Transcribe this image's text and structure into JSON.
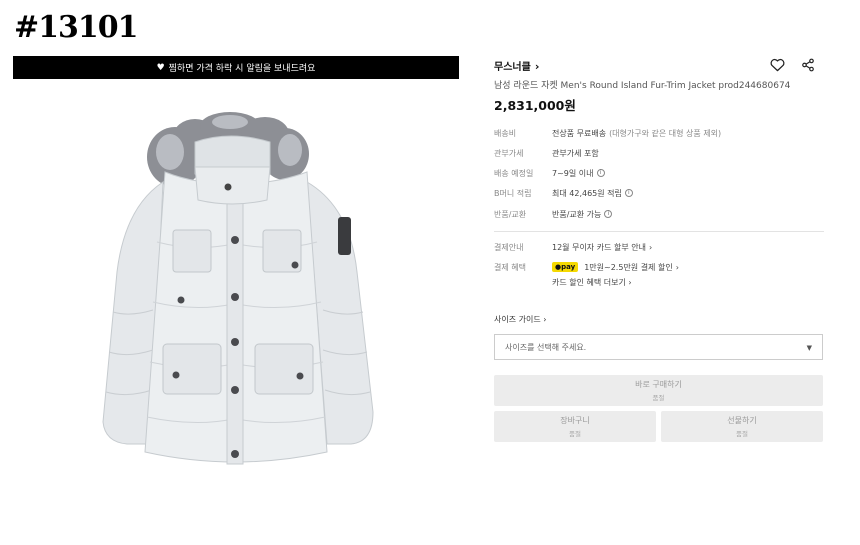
{
  "page_id": "#13101",
  "banner": {
    "text": "찜하면 가격 하락 시 알림을 보내드려요"
  },
  "product": {
    "brand": "무스너클",
    "name": "남성 라운드 자켓 Men's Round Island Fur-Trim Jacket prod244680674",
    "price": "2,831,000원"
  },
  "info": [
    {
      "label": "배송비",
      "value": "전상품 무료배송",
      "note": "(대형가구와 같은 대형 상품 제외)",
      "icon": ""
    },
    {
      "label": "관부가세",
      "value": "관부가세 포함",
      "note": "",
      "icon": ""
    },
    {
      "label": "배송 예정일",
      "value": "7~9일 이내",
      "note": "",
      "icon": "info-icon"
    },
    {
      "label": "B머니 적립",
      "value": "최대 42,465원 적립",
      "note": "",
      "icon": "info-icon"
    },
    {
      "label": "반품/교환",
      "value": "반품/교환 가능",
      "note": "",
      "icon": "info-icon"
    }
  ],
  "payment": {
    "guide_label": "결제안내",
    "guide_value": "12월 무이자 카드 할부 안내",
    "benefit_label": "결제 혜택",
    "pay_badge": "●pay",
    "benefit_value": "1만원~2.5만원 결제 할인",
    "card_link": "카드 할인 혜택 더보기"
  },
  "size": {
    "guide": "사이즈 가이드",
    "placeholder": "사이즈를 선택해 주세요."
  },
  "buttons": {
    "buy": "바로 구매하기",
    "buy_sub": "품절",
    "cart": "장바구니",
    "cart_sub": "품절",
    "gift": "선물하기",
    "gift_sub": "품절"
  },
  "colors": {
    "banner_bg": "#000000",
    "pay_badge": "#f5d900",
    "button_bg": "#ececec"
  }
}
